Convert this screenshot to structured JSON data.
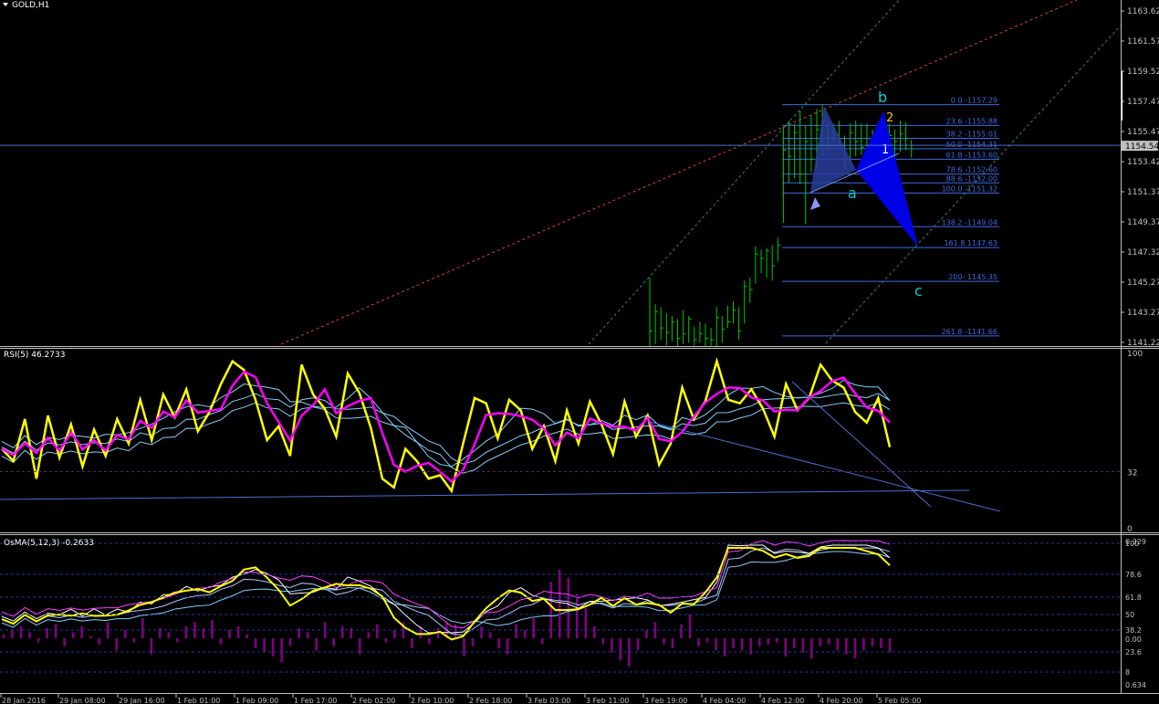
{
  "window": {
    "title": "GOLD,H1"
  },
  "price_panel": {
    "y_ticks": [
      "1163.62",
      "1161.57",
      "1159.52",
      "1157.47",
      "1155.47",
      "1153.42",
      "1151.37",
      "1149.37",
      "1147.32",
      "1145.27",
      "1143.27",
      "1141.22"
    ],
    "current_price": "1154.54",
    "fib_labels": [
      "0.0 -1157.29",
      "23.6 -1155.88",
      "38.2 -1155.01",
      "50.0 -1154.31",
      "61.8 -1153.60",
      "78.6 -1152.60",
      "88.6 -1152.00",
      "100.0 -1151.32",
      "138.2 -1149.04",
      "161.8 1147.63",
      "200- 1145.35",
      "261.8 -1141.66"
    ],
    "wave_labels": {
      "a": "a",
      "b": "b",
      "c": "c",
      "n1": "1",
      "n2": "2"
    }
  },
  "rsi_panel": {
    "title": "RSI(5) 46.2733",
    "y_ticks": [
      "100",
      "32",
      "0"
    ]
  },
  "osma_panel": {
    "title": "OsMA(5,12,3) -0.2633",
    "y_ticks": [
      "0.329",
      "100",
      "78.6",
      "61.8",
      "50",
      "38.2",
      "0.00",
      "23.6",
      "8",
      "0.634"
    ]
  },
  "x_axis": {
    "labels": [
      "28 Jan 2016",
      "29 Jan 08:00",
      "29 Jan 16:00",
      "1 Feb 01:00",
      "1 Feb 09:00",
      "1 Feb 17:00",
      "2 Feb 02:00",
      "2 Feb 10:00",
      "2 Feb 18:00",
      "3 Feb 03:00",
      "3 Feb 11:00",
      "3 Feb 19:00",
      "4 Feb 04:00",
      "4 Feb 12:00",
      "4 Feb 20:00",
      "5 Feb 05:00"
    ]
  },
  "colors": {
    "bars": "#00c800",
    "grid": "#1a2a8a",
    "axis": "#c0c0c0",
    "rsi": "#ffff00",
    "ma": "#ff00ff",
    "band": "#87cefa",
    "osma_hist": "#800080",
    "fib": "#4169e1",
    "wave": "#00ced1",
    "pattern": "#0000ff"
  },
  "chart_data": [
    {
      "type": "bar",
      "title": "GOLD,H1",
      "ylim": [
        1141.22,
        1163.62
      ],
      "fib_levels": [
        {
          "pct": 0.0,
          "price": 1157.29
        },
        {
          "pct": 23.6,
          "price": 1155.88
        },
        {
          "pct": 38.2,
          "price": 1155.01
        },
        {
          "pct": 50.0,
          "price": 1154.31
        },
        {
          "pct": 61.8,
          "price": 1153.6
        },
        {
          "pct": 78.6,
          "price": 1152.6
        },
        {
          "pct": 88.6,
          "price": 1152.0
        },
        {
          "pct": 100.0,
          "price": 1151.32
        },
        {
          "pct": 138.2,
          "price": 1149.04
        },
        {
          "pct": 161.8,
          "price": 1147.63
        },
        {
          "pct": 200.0,
          "price": 1145.35
        },
        {
          "pct": 261.8,
          "price": 1141.66
        }
      ],
      "bars_hlc": [
        [
          1145.6,
          1140.9,
          1142.0
        ],
        [
          1143.8,
          1141.1,
          1143.3
        ],
        [
          1143.6,
          1141.4,
          1142.2
        ],
        [
          1143.2,
          1141.0,
          1141.9
        ],
        [
          1143.0,
          1141.3,
          1142.6
        ],
        [
          1142.8,
          1141.0,
          1141.5
        ],
        [
          1143.4,
          1141.1,
          1141.8
        ],
        [
          1143.0,
          1141.2,
          1142.8
        ],
        [
          1142.3,
          1141.0,
          1141.4
        ],
        [
          1142.6,
          1141.2,
          1141.8
        ],
        [
          1142.5,
          1140.9,
          1141.5
        ],
        [
          1142.2,
          1141.0,
          1141.4
        ],
        [
          1143.6,
          1140.9,
          1142.9
        ],
        [
          1143.0,
          1141.2,
          1142.1
        ],
        [
          1143.7,
          1142.2,
          1142.6
        ],
        [
          1144.0,
          1142.5,
          1143.4
        ],
        [
          1143.6,
          1141.4,
          1142.0
        ],
        [
          1145.4,
          1142.5,
          1145.0
        ],
        [
          1145.6,
          1143.9,
          1144.8
        ],
        [
          1147.7,
          1145.2,
          1147.2
        ],
        [
          1147.5,
          1145.9,
          1146.9
        ],
        [
          1147.6,
          1145.6,
          1147.4
        ],
        [
          1147.8,
          1145.4,
          1146.4
        ],
        [
          1148.3,
          1146.7,
          1147.8
        ],
        [
          1155.8,
          1149.3,
          1154.2
        ],
        [
          1156.2,
          1152.0,
          1153.8
        ],
        [
          1156.0,
          1152.3,
          1155.4
        ],
        [
          1156.9,
          1151.9,
          1152.6
        ],
        [
          1155.9,
          1149.2,
          1154.8
        ],
        [
          1156.6,
          1152.7,
          1153.6
        ],
        [
          1157.0,
          1152.9,
          1155.6
        ],
        [
          1157.3,
          1153.8,
          1156.2
        ],
        [
          1156.2,
          1154.4,
          1155.6
        ],
        [
          1156.0,
          1154.7,
          1155.2
        ],
        [
          1156.2,
          1154.6,
          1155.0
        ],
        [
          1155.2,
          1152.9,
          1153.4
        ],
        [
          1156.0,
          1153.5,
          1155.4
        ],
        [
          1156.2,
          1153.8,
          1154.8
        ],
        [
          1156.0,
          1153.9,
          1154.4
        ],
        [
          1156.0,
          1153.3,
          1154.5
        ],
        [
          1155.6,
          1153.4,
          1154.8
        ],
        [
          1155.7,
          1154.0,
          1155.1
        ],
        [
          1156.2,
          1154.3,
          1155.8
        ],
        [
          1156.0,
          1153.8,
          1155.2
        ],
        [
          1155.6,
          1153.5,
          1154.8
        ],
        [
          1156.2,
          1154.1,
          1155.3
        ],
        [
          1156.1,
          1154.2,
          1155.0
        ],
        [
          1154.9,
          1153.7,
          1154.3
        ]
      ]
    },
    {
      "type": "line",
      "title": "RSI(5) 46.2733",
      "ylim": [
        0,
        100
      ],
      "series": [
        {
          "values": [
            45,
            38,
            62,
            28,
            64,
            40,
            59,
            35,
            56,
            41,
            62,
            48,
            73,
            50,
            76,
            63,
            79,
            55,
            66,
            82,
            95,
            90,
            73,
            50,
            58,
            41,
            93,
            76,
            68,
            52,
            88,
            77,
            57,
            28,
            23,
            45,
            38,
            28,
            30,
            21,
            48,
            74,
            71,
            51,
            73,
            67,
            45,
            58,
            38,
            67,
            48,
            72,
            59,
            42,
            72,
            52,
            64,
            36,
            48,
            80,
            62,
            72,
            95,
            73,
            71,
            79,
            68,
            52,
            82,
            67,
            74,
            93,
            84,
            80,
            66,
            60,
            74,
            46
          ]
        }
      ]
    },
    {
      "type": "bar",
      "title": "OsMA(5,12,3) -0.2633",
      "series": [
        {
          "name": "OsMA",
          "values": [
            2,
            4,
            6,
            3,
            -2,
            5,
            7,
            -4,
            3,
            6,
            1,
            -3,
            8,
            -6,
            4,
            -2,
            10,
            -8,
            5,
            3,
            -2,
            6,
            8,
            5,
            9,
            -3,
            4,
            6,
            2,
            -5,
            -7,
            -9,
            -12,
            -4,
            5,
            3,
            -6,
            8,
            -4,
            6,
            5,
            -8,
            3,
            7,
            -2,
            4,
            8,
            -5,
            6,
            -3,
            5,
            8,
            7,
            -9,
            -4,
            6,
            3,
            -5,
            -8,
            7,
            4,
            10,
            -3,
            28,
            34,
            30,
            22,
            15,
            6,
            -3,
            -7,
            -11,
            -14,
            -6,
            4,
            8,
            -3,
            -5,
            7,
            12,
            -4,
            -2,
            -6,
            -9,
            -5,
            -6,
            -8,
            -4,
            -3,
            -2,
            -9,
            -5,
            -7,
            -10,
            -4,
            -3,
            -6,
            -8,
            -10,
            -6,
            -4,
            -5,
            -7
          ]
        }
      ]
    }
  ]
}
